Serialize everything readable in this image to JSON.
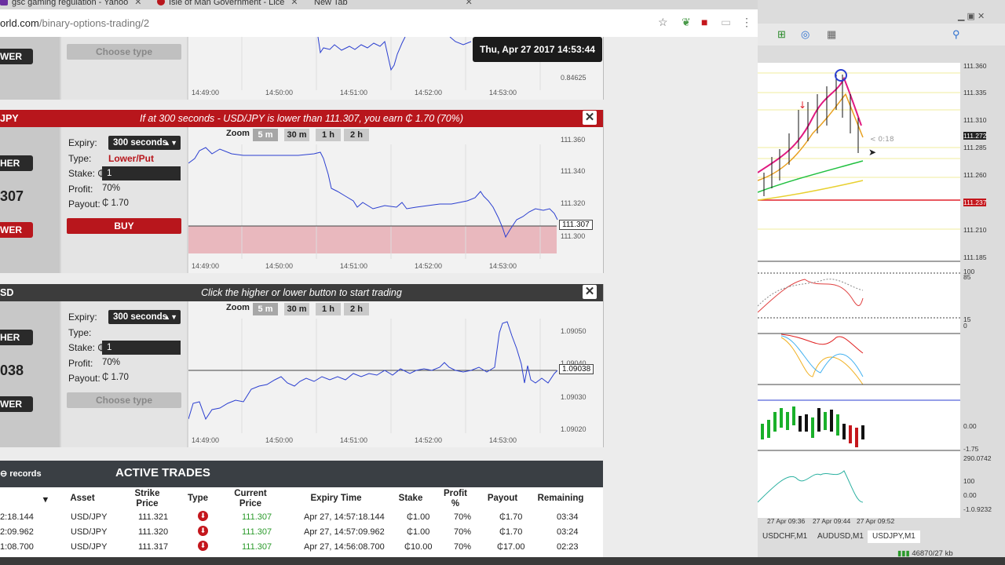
{
  "browser": {
    "tabs": [
      {
        "label": "gsc gaming regulation - Yahoo",
        "fav": "#6b2fa0"
      },
      {
        "label": "Isle of Man Government - Lice",
        "fav": "#b8161c"
      },
      {
        "label": "New Tab",
        "fav": "#dddddd"
      }
    ],
    "url_domain": "orld.com",
    "url_path": "/binary-options-trading/2"
  },
  "datetime": "Thu, Apr 27 2017   14:53:44",
  "panel_top": {
    "button_label": "WER",
    "choose_type": "Choose type",
    "y_tick": "0.84625",
    "x_ticks": [
      "14:49:00",
      "14:50:00",
      "14:51:00",
      "14:52:00",
      "14:53:00"
    ]
  },
  "panel_jpy": {
    "symbol": "JPY",
    "message": "If at 300 seconds - USD/JPY is lower than 111.307, you earn ₵ 1.70 (70%)",
    "higher_label": "HER",
    "price": "307",
    "lower_label": "WER",
    "expiry_label": "Expiry:",
    "expiry_value": "300 seconds",
    "type_label": "Type:",
    "type_value": "Lower/Put",
    "stake_label": "Stake: ₵",
    "stake_value": "1",
    "profit_label": "Profit:",
    "profit_value": "70%",
    "payout_label": "Payout:",
    "payout_value": "₵  1.70",
    "buy_label": "BUY",
    "zoom_label": "Zoom",
    "zoom_options": [
      "5 m",
      "30 m",
      "1 h",
      "2 h"
    ],
    "y_ticks": [
      "111.360",
      "111.340",
      "111.320",
      "111.300"
    ],
    "price_tag": "111.307",
    "x_ticks": [
      "14:49:00",
      "14:50:00",
      "14:51:00",
      "14:52:00",
      "14:53:00"
    ]
  },
  "panel_eur": {
    "symbol": "SD",
    "message": "Click the higher or lower button to start trading",
    "higher_label": "HER",
    "price": "038",
    "lower_label": "WER",
    "expiry_label": "Expiry:",
    "expiry_value": "300 seconds",
    "type_label": "Type:",
    "type_value": "",
    "stake_label": "Stake: ₵",
    "stake_value": "1",
    "profit_label": "Profit:",
    "profit_value": "70%",
    "payout_label": "Payout:",
    "payout_value": "₵  1.70",
    "choose_type": "Choose type",
    "zoom_label": "Zoom",
    "zoom_options": [
      "5 m",
      "30 m",
      "1 h",
      "2 h"
    ],
    "y_ticks": [
      "1.09050",
      "1.09040",
      "1.09030",
      "1.09020"
    ],
    "price_tag": "1.09038",
    "x_ticks": [
      "14:49:00",
      "14:50:00",
      "14:51:00",
      "14:52:00",
      "14:53:00"
    ]
  },
  "trades": {
    "title": "ACTIVE TRADES",
    "records_label": "records",
    "columns": [
      "",
      "Asset",
      "Strike Price",
      "Type",
      "Current Price",
      "Expiry Time",
      "Stake",
      "Profit %",
      "Payout",
      "Remaining"
    ],
    "rows": [
      {
        "time": "2:18.144",
        "asset": "USD/JPY",
        "strike": "111.321",
        "current": "111.307",
        "expiry": "Apr 27, 14:57:18.144",
        "stake": "₵1.00",
        "profit": "70%",
        "payout": "₵1.70",
        "remaining": "03:34"
      },
      {
        "time": "2:09.962",
        "asset": "USD/JPY",
        "strike": "111.320",
        "current": "111.307",
        "expiry": "Apr 27, 14:57:09.962",
        "stake": "₵1.00",
        "profit": "70%",
        "payout": "₵1.70",
        "remaining": "03:24"
      },
      {
        "time": "1:08.700",
        "asset": "USD/JPY",
        "strike": "111.317",
        "current": "111.307",
        "expiry": "Apr 27, 14:56:08.700",
        "stake": "₵10.00",
        "profit": "70%",
        "payout": "₵17.00",
        "remaining": "02:23"
      }
    ]
  },
  "mt4": {
    "y_ticks": [
      "111.360",
      "111.335",
      "111.310",
      "111.285",
      "111.260",
      "111.235",
      "111.210",
      "111.185"
    ],
    "price_label": "111.272",
    "line_label": "111.237",
    "countdown": "< 0:18",
    "ind1_ticks": [
      "100",
      "85",
      "15",
      "0"
    ],
    "ind3_ticks": [
      "0.00",
      "-1.75"
    ],
    "ind4_ticks": [
      "290.0742",
      "100",
      "0.00",
      "-1.0.9232"
    ],
    "x_ticks": [
      "27 Apr 09:36",
      "27 Apr 09:44",
      "27 Apr 09:52"
    ],
    "tabs": [
      "USDCHF,M1",
      "AUDUSD,M1",
      "USDJPY,M1"
    ],
    "status": "46870/27 kb"
  }
}
